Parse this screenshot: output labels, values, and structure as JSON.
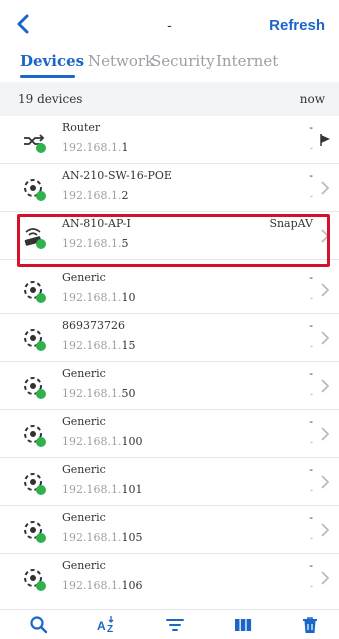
{
  "header": {
    "title": "-",
    "refresh_label": "Refresh"
  },
  "tabs": [
    {
      "label": "Devices"
    },
    {
      "label": "Network"
    },
    {
      "label": "Security"
    },
    {
      "label": "Internet"
    }
  ],
  "summary": {
    "count": "19 devices",
    "updated": "now"
  },
  "devices": [
    {
      "name": "Router",
      "ip_prefix": "192.168.1.",
      "ip_suffix": "1",
      "vendor": "-",
      "vendor_sub": "-",
      "icon": "router-icon"
    },
    {
      "name": "AN-210-SW-16-POE",
      "ip_prefix": "192.168.1.",
      "ip_suffix": "2",
      "vendor": "-",
      "vendor_sub": "-",
      "icon": "generic-device-icon"
    },
    {
      "name": "AN-810-AP-I",
      "ip_prefix": "192.168.1.",
      "ip_suffix": "5",
      "vendor": "SnapAV",
      "vendor_sub": "",
      "icon": "wifi-ap-icon"
    },
    {
      "name": "Generic",
      "ip_prefix": "192.168.1.",
      "ip_suffix": "10",
      "vendor": "-",
      "vendor_sub": "-",
      "icon": "generic-device-icon"
    },
    {
      "name": "869373726",
      "ip_prefix": "192.168.1.",
      "ip_suffix": "15",
      "vendor": "-",
      "vendor_sub": "-",
      "icon": "generic-device-icon"
    },
    {
      "name": "Generic",
      "ip_prefix": "192.168.1.",
      "ip_suffix": "50",
      "vendor": "-",
      "vendor_sub": "-",
      "icon": "generic-device-icon"
    },
    {
      "name": "Generic",
      "ip_prefix": "192.168.1.",
      "ip_suffix": "100",
      "vendor": "-",
      "vendor_sub": "-",
      "icon": "generic-device-icon"
    },
    {
      "name": "Generic",
      "ip_prefix": "192.168.1.",
      "ip_suffix": "101",
      "vendor": "-",
      "vendor_sub": "-",
      "icon": "generic-device-icon"
    },
    {
      "name": "Generic",
      "ip_prefix": "192.168.1.",
      "ip_suffix": "105",
      "vendor": "-",
      "vendor_sub": "-",
      "icon": "generic-device-icon"
    },
    {
      "name": "Generic",
      "ip_prefix": "192.168.1.",
      "ip_suffix": "106",
      "vendor": "-",
      "vendor_sub": "-",
      "icon": "generic-device-icon"
    }
  ],
  "toolbar": {
    "icons": [
      "search-icon",
      "sort-az-icon",
      "filter-icon",
      "columns-icon",
      "trash-icon"
    ]
  },
  "colors": {
    "accent": "#1a66c9",
    "status_online": "#2fb24c",
    "highlight": "#d4122c"
  }
}
